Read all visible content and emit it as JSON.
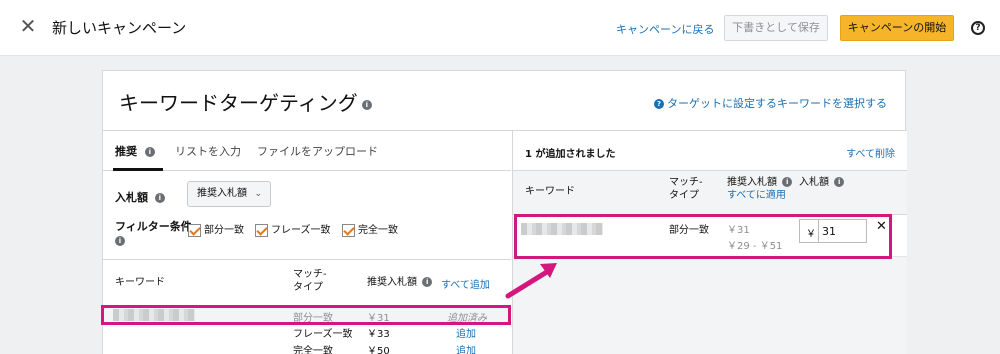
{
  "header": {
    "close_glyph": "✕",
    "title": "新しいキャンペーン",
    "back_link": "キャンペーンに戻る",
    "save_draft": "下書きとして保存",
    "start_button": "キャンペーンの開始",
    "help_glyph": "?"
  },
  "card": {
    "title": "キーワードターゲティング",
    "info_glyph": "i",
    "select_link": "ターゲットに設定するキーワードを選択する",
    "q_glyph": "?"
  },
  "left": {
    "tabs": [
      "推奨",
      "リストを入力",
      "ファイルをアップロード"
    ],
    "bid_label": "入札額",
    "bid_select": "推奨入札額",
    "bid_chevron": "⌄",
    "filter_label": "フィルター条件",
    "filters": [
      "部分一致",
      "フレーズ一致",
      "完全一致"
    ],
    "table_head": {
      "keyword": "キーワード",
      "match_line1": "マッチ-",
      "match_line2": "タイプ",
      "suggested": "推奨入札額",
      "add_all": "すべて追加"
    },
    "rows": [
      {
        "match": "部分一致",
        "bid": "￥31",
        "action": "追加済み"
      },
      {
        "match": "フレーズ一致",
        "bid": "￥33",
        "action": "追加"
      },
      {
        "match": "完全一致",
        "bid": "￥50",
        "action": "追加"
      }
    ]
  },
  "right": {
    "count_text": "1 が追加されました",
    "delete_all": "すべて削除",
    "head": {
      "keyword": "キーワード",
      "match_line1": "マッチ-",
      "match_line2": "タイプ",
      "suggested": "推奨入札額",
      "apply_all": "すべてに適用",
      "bid": "入札額"
    },
    "row": {
      "match": "部分一致",
      "suggested": "￥31",
      "range": "￥29 - ￥51",
      "currency": "￥",
      "bid_value": "31",
      "remove_glyph": "✕"
    }
  },
  "colors": {
    "accent_link": "#1a6fb5",
    "start_button": "#f5b42a",
    "highlight": "#d2177f",
    "checkbox": "#e7761a"
  }
}
